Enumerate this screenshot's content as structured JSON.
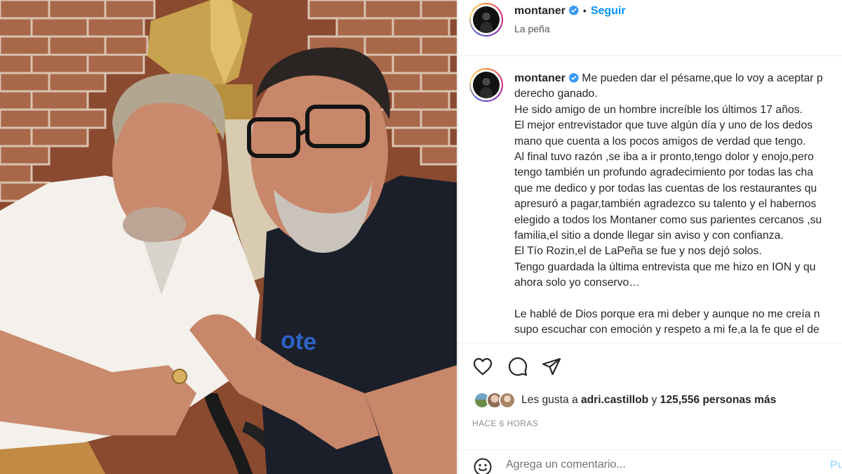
{
  "post": {
    "photo_description_icon": "photo-icon"
  },
  "header": {
    "username": "montaner",
    "separator": "•",
    "follow_label": "Seguir",
    "location": "La peña"
  },
  "caption": {
    "username": "montaner",
    "lines": [
      "Me pueden dar el pésame,que lo voy a aceptar p",
      "derecho ganado.",
      "He sido amigo de un hombre increíble los últimos 17 años.",
      "El mejor entrevistador que tuve algún día y uno de los dedos",
      "mano que cuenta a los pocos amigos de verdad que tengo.",
      "Al final tuvo razón ,se iba a ir pronto,tengo dolor y enojo,pero",
      "tengo también un profundo agradecimiento por todas las cha",
      "que me dedico y por todas las cuentas de los restaurantes qu",
      "apresuró a pagar,también agradezco su talento y el habernos",
      "elegido a todos los Montaner como sus parientes cercanos ,su",
      "familia,el sitio a donde llegar sin aviso y con confianza.",
      "El Tío Rozin,el de LaPeña se fue y nos dejó solos.",
      "Tengo guardada la última entrevista que me hizo en ION y qu",
      "ahora solo yo conservo…",
      "",
      "Le hablé de Dios porque era mi deber y aunque no me creía n",
      "supo escuchar con emoción y respeto a mi fe,a la fe que el de"
    ]
  },
  "actions": {
    "like_icon": "heart-icon",
    "comment_icon": "comment-icon",
    "share_icon": "share-icon"
  },
  "likes": {
    "prefix": "Les gusta a",
    "user": "adri.castillob",
    "connector": "y",
    "count": "125,556 personas más"
  },
  "time_ago": "HACE 6 HORAS",
  "comment": {
    "placeholder": "Agrega un comentario...",
    "post_label": "Pu"
  },
  "colors": {
    "accent": "#0095f6",
    "verified": "#3897f0",
    "post_disabled": "#b2dffc"
  }
}
